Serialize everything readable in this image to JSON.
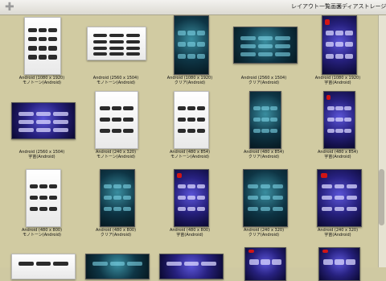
{
  "toolbar": {
    "add_icon": "plus-icon",
    "menu": [
      "レイアウト一覧画面",
      "メディアストレージ"
    ]
  },
  "grid": {
    "items": [
      {
        "caption": [
          "Android (1080 x 1920)",
          "モノトーン(Android)"
        ],
        "theme": "mono"
      },
      {
        "caption": [
          "Android (2560 x 1504)",
          "モノトーン(Android)"
        ],
        "theme": "mono"
      },
      {
        "caption": [
          "Android (1080 x 1920)",
          "クリア(Android)"
        ],
        "theme": "clear"
      },
      {
        "caption": [
          "Android (2560 x 1504)",
          "クリア(Android)"
        ],
        "theme": "clear"
      },
      {
        "caption": [
          "Android (1080 x 1920)",
          "宇宙(Android)"
        ],
        "theme": "space"
      },
      {
        "caption": [
          "Android (2560 x 1504)",
          "宇宙(Android)"
        ],
        "theme": "space"
      },
      {
        "caption": [
          "Android (240 x 320)",
          "モノトーン(Android)"
        ],
        "theme": "mono"
      },
      {
        "caption": [
          "Android (480 x 854)",
          "モノトーン(Android)"
        ],
        "theme": "mono"
      },
      {
        "caption": [
          "Android (480 x 854)",
          "クリア(Android)"
        ],
        "theme": "clear"
      },
      {
        "caption": [
          "Android (480 x 854)",
          "宇宙(Android)"
        ],
        "theme": "space"
      },
      {
        "caption": [
          "Android (480 x 800)",
          "モノトーン(Android)"
        ],
        "theme": "mono"
      },
      {
        "caption": [
          "Android (480 x 800)",
          "クリア(Android)"
        ],
        "theme": "clear"
      },
      {
        "caption": [
          "Android (480 x 800)",
          "宇宙(Android)"
        ],
        "theme": "space"
      },
      {
        "caption": [
          "Android (240 x 320)",
          "クリア(Android)"
        ],
        "theme": "clear"
      },
      {
        "caption": [
          "Android (240 x 320)",
          "宇宙(Android)"
        ],
        "theme": "space"
      },
      {
        "caption": [
          "",
          ""
        ],
        "theme": "mono"
      },
      {
        "caption": [
          "",
          ""
        ],
        "theme": "clear"
      },
      {
        "caption": [
          "",
          ""
        ],
        "theme": "space"
      },
      {
        "caption": [
          "",
          ""
        ],
        "theme": "space"
      },
      {
        "caption": [
          "",
          ""
        ],
        "theme": "space"
      }
    ]
  }
}
